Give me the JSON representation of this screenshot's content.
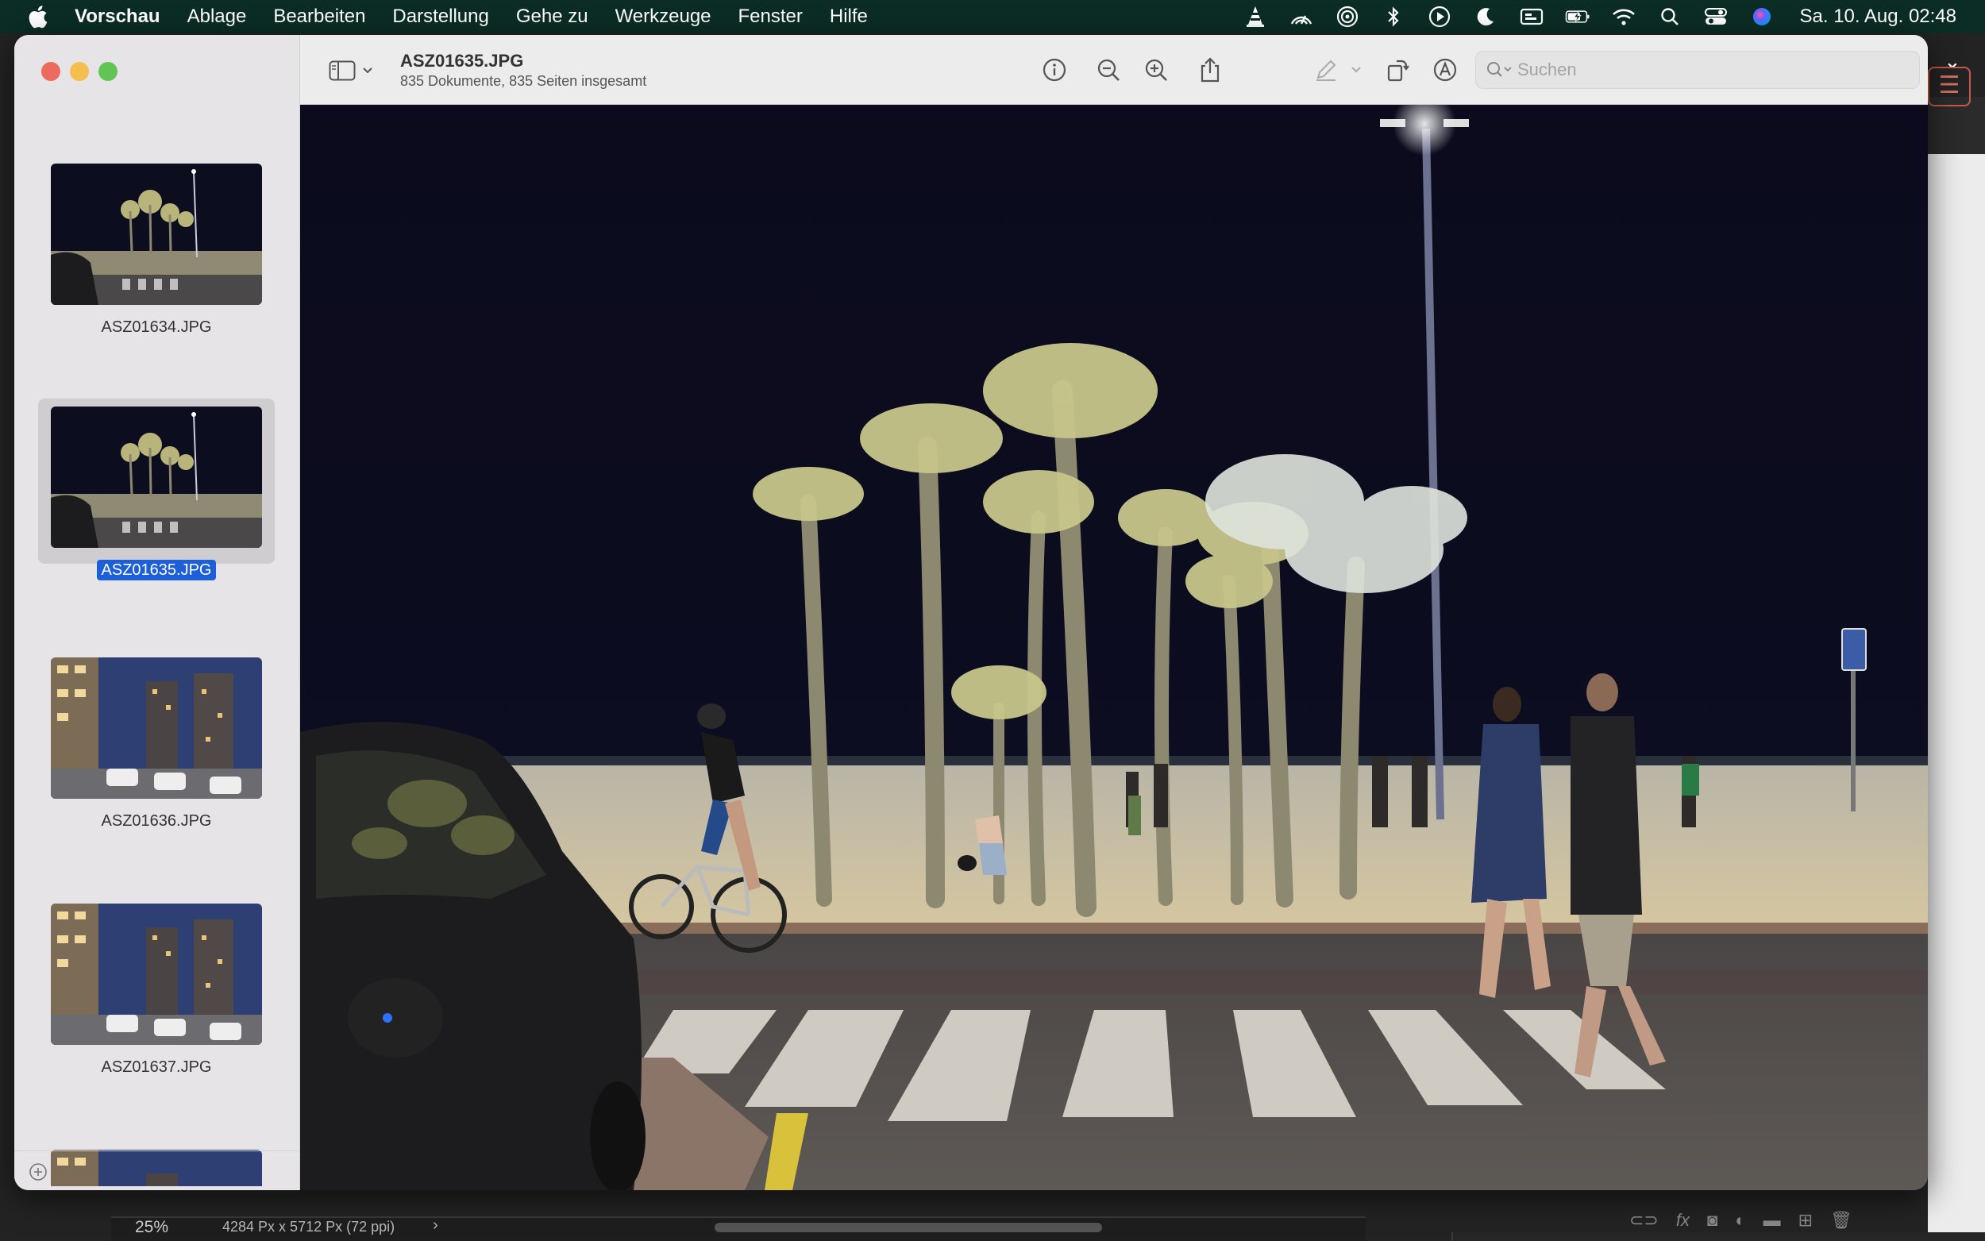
{
  "menubar": {
    "app_name": "Vorschau",
    "items": [
      "Ablage",
      "Bearbeiten",
      "Darstellung",
      "Gehe zu",
      "Werkzeuge",
      "Fenster",
      "Hilfe"
    ],
    "clock": "Sa. 10. Aug.  02:48",
    "status_icons": [
      "vlc-icon",
      "network-icon",
      "airdrop-icon",
      "bluetooth-icon",
      "play-icon",
      "moon-icon",
      "display-icon",
      "battery-charging-icon",
      "wifi-icon",
      "search-icon",
      "control-center-icon",
      "siri-icon"
    ]
  },
  "window": {
    "title": "ASZ01635.JPG",
    "subtitle": "835 Dokumente, 835 Seiten insgesamt",
    "search_placeholder": "Suchen",
    "thumbnails": [
      {
        "name": "ASZ01634.JPG",
        "scene": "night-beach"
      },
      {
        "name": "ASZ01635.JPG",
        "scene": "night-beach",
        "selected": true
      },
      {
        "name": "ASZ01636.JPG",
        "scene": "city-street"
      },
      {
        "name": "ASZ01637.JPG",
        "scene": "city-street"
      },
      {
        "name": "",
        "scene": "city-street"
      }
    ]
  },
  "background_app": {
    "zoom": "25%",
    "dimensions": "4284 Px x 5712 Px (72 ppi)"
  },
  "colors": {
    "menubar_bg": "#0b2d25",
    "selection_blue": "#1d5fd8",
    "sky": "#0c0c1e"
  }
}
